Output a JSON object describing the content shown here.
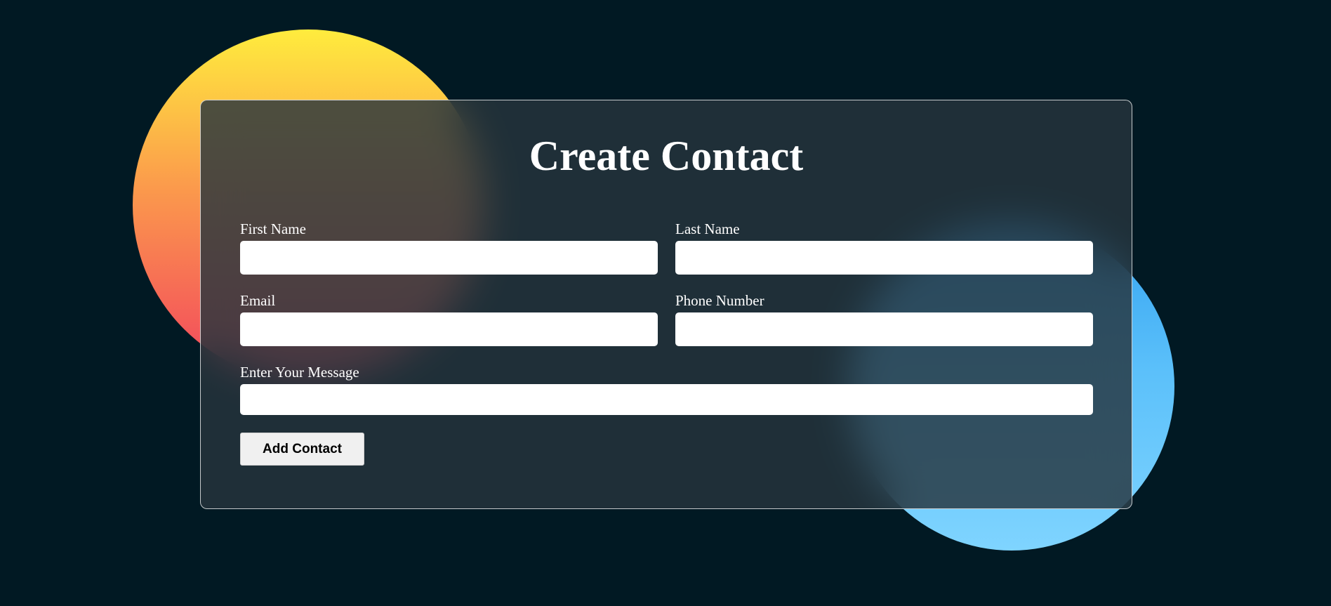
{
  "form": {
    "title": "Create Contact",
    "fields": {
      "first_name": {
        "label": "First Name",
        "value": "",
        "placeholder": ""
      },
      "last_name": {
        "label": "Last Name",
        "value": "",
        "placeholder": ""
      },
      "email": {
        "label": "Email",
        "value": "",
        "placeholder": ""
      },
      "phone": {
        "label": "Phone Number",
        "value": "",
        "placeholder": ""
      },
      "message": {
        "label": "Enter Your Message",
        "value": "",
        "placeholder": ""
      }
    },
    "submit_label": "Add Contact"
  },
  "theme": {
    "background": "#011923",
    "warm_circle_top": "#ffec3d",
    "warm_circle_bottom": "#f2435e",
    "cool_circle_top": "#34a3f0",
    "cool_circle_bottom": "#7fd4ff",
    "card_border": "#ffffff",
    "text": "#ffffff"
  }
}
